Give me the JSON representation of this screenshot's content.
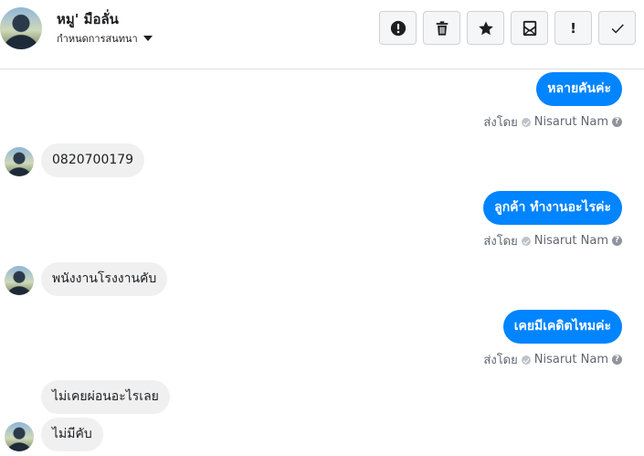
{
  "header": {
    "contact_name": "หมู' มือลั่น",
    "conversation_settings": "กำหนดการสนทนา",
    "toolbar": [
      {
        "name": "mark-spam-button",
        "icon": "alert-circle-icon"
      },
      {
        "name": "delete-button",
        "icon": "trash-icon"
      },
      {
        "name": "star-button",
        "icon": "star-icon"
      },
      {
        "name": "mark-unread-button",
        "icon": "envelope-icon"
      },
      {
        "name": "follow-up-button",
        "icon": "exclamation-icon",
        "label": "!"
      },
      {
        "name": "mark-done-button",
        "icon": "check-icon"
      }
    ]
  },
  "messages": [
    {
      "direction": "outgoing",
      "text": "หลายคันค่ะ",
      "sent_by_label": "ส่งโดย",
      "sender": "Nisarut Nam"
    },
    {
      "direction": "incoming",
      "text": "0820700179"
    },
    {
      "direction": "outgoing",
      "text": "ลูกค้า ทำงานอะไรค่ะ",
      "sent_by_label": "ส่งโดย",
      "sender": "Nisarut Nam"
    },
    {
      "direction": "incoming",
      "text": "พนังงานโรงงานคับ"
    },
    {
      "direction": "outgoing",
      "text": "เคยมีเคดิตไหมค่ะ",
      "sent_by_label": "ส่งโดย",
      "sender": "Nisarut Nam"
    },
    {
      "direction": "incoming",
      "text": "ไม่เคยผ่อนอะไรเลย"
    },
    {
      "direction": "incoming",
      "text": "ไม่มีคับ"
    }
  ],
  "colors": {
    "outgoing_bubble": "#0084ff",
    "incoming_bubble": "#f0f0f0",
    "meta_text": "#606770"
  }
}
